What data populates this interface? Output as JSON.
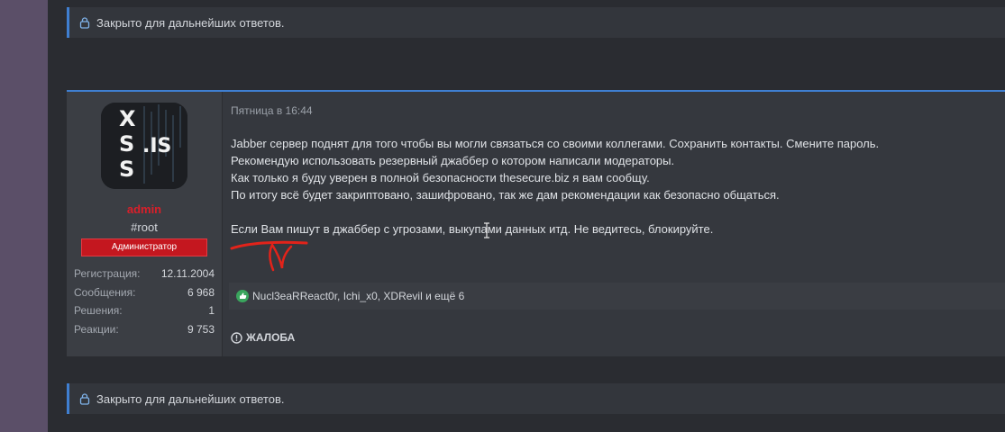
{
  "notices": {
    "top_text": "Закрыто для дальнейших ответов.",
    "bottom_text": "Закрыто для дальнейших ответов."
  },
  "user": {
    "avatar_icon": "xss-is-logo",
    "avatar_text": "X S S .IS",
    "username": "admin",
    "title": "#root",
    "role": "Администратор",
    "stats": [
      {
        "label": "Регистрация:",
        "value": "12.11.2004"
      },
      {
        "label": "Сообщения:",
        "value": "6 968"
      },
      {
        "label": "Решения:",
        "value": "1"
      },
      {
        "label": "Реакции:",
        "value": "9 753"
      }
    ]
  },
  "post": {
    "date": "Пятница в 16:44",
    "lines": [
      "Jabber сервер поднят для того чтобы вы могли связаться со своими коллегами. Сохранить контакты. Смените пароль.",
      "Рекомендую использовать резервный джаббер о котором написали модераторы.",
      "Как только я буду уверен в полной безопасности thesecure.biz я вам сообщу.",
      "По итогу всё будет закриптовано, зашифровано, так же дам рекомендации как безопасно общаться."
    ],
    "warning_line": "Если Вам пишут в джаббер с угрозами, выкупами данных итд. Не ведитесь, блокируйте.",
    "reactions_text": "Nucl3eaRReact0r, Ichi_x0, XDRevil и ещё 6",
    "report_label": "ЖАЛОБА"
  },
  "colors": {
    "accent": "#3f7fd1",
    "username": "#d91f2a",
    "role_banner": "#c4171f",
    "scribble": "#e2231a"
  }
}
